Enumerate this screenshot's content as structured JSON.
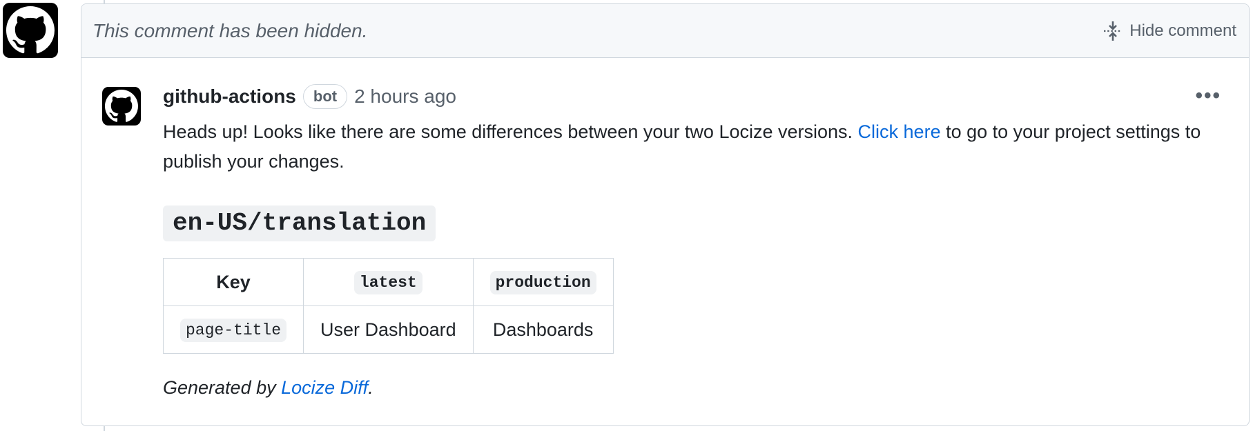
{
  "hidden_bar": {
    "text": "This comment has been hidden.",
    "hide_label": "Hide comment"
  },
  "comment": {
    "author": "github-actions",
    "badge": "bot",
    "time": "2 hours ago",
    "body_part1": "Heads up! Looks like there are some differences between your two Locize versions. ",
    "link_text": "Click here",
    "body_part2": " to go to your project settings to publish your changes.",
    "heading": "en-US/translation",
    "table": {
      "headers": [
        "Key",
        "latest",
        "production"
      ],
      "rows": [
        [
          "page-title",
          "User Dashboard",
          "Dashboards"
        ]
      ]
    },
    "footer_prefix": "Generated by ",
    "footer_link": "Locize Diff",
    "footer_suffix": "."
  },
  "icons": {
    "avatar": "github-octocat-icon",
    "unfold": "unfold-icon",
    "more": "kebab-horizontal-icon"
  }
}
